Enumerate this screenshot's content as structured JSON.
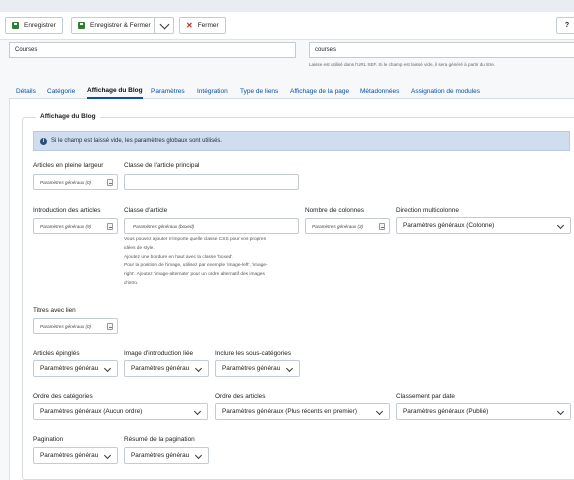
{
  "toolbar": {
    "save_label": "Enregistrer",
    "save_close_label": "Enregistrer & Fermer",
    "close_label": "Fermer",
    "help_label": "?"
  },
  "title": {
    "value": "Courses"
  },
  "alias": {
    "value": "courses",
    "help": "Laisse est utilisé dans l'URL SEF. Si le champ est laissé vide, il sera généré à partir du titre."
  },
  "tabs": [
    {
      "label": "Détails"
    },
    {
      "label": "Catégorie"
    },
    {
      "label": "Affichage du Blog",
      "active": true
    },
    {
      "label": "Paramètres"
    },
    {
      "label": "Intégration"
    },
    {
      "label": "Type de liens"
    },
    {
      "label": "Affichage de la page"
    },
    {
      "label": "Métadonnées"
    },
    {
      "label": "Assignation de modules"
    }
  ],
  "fieldset": {
    "legend": "Affichage du Blog",
    "info": "Si le champ est laissé vide, les paramètres globaux sont utilisés."
  },
  "fields": {
    "leading": {
      "label": "Articles en pleine largeur",
      "value": "Paramètres généraux (0)"
    },
    "leading_class": {
      "label": "Classe de l'article principal",
      "value": ""
    },
    "intro": {
      "label": "Introduction des articles",
      "value": "Paramètres généraux (9)"
    },
    "article_class": {
      "label": "Classe d'article",
      "value": "Paramètres généraux (boxed)",
      "hint": [
        "Vous pouvez ajouter n'importe quelle classe CSS pour vos propres",
        "idées de style.",
        "Ajoutez une bordure en haut avec la classe 'boxed'.",
        "Pour la position de l'image, utilisez par exemple 'image-left', 'image-",
        "right'. Ajoutez 'image-alternate' pour un ordre alternatif des images",
        "d'intro."
      ]
    },
    "columns": {
      "label": "Nombre de colonnes",
      "value": "Paramètres généraux (3)"
    },
    "direction": {
      "label": "Direction multicolonne",
      "value": "Paramètres généraux (Colonne)"
    },
    "links": {
      "label": "Titres avec lien",
      "value": "Paramètres généraux (0)"
    },
    "pinned": {
      "label": "Articles épinglés",
      "value": "Paramètres générau"
    },
    "linked_image": {
      "label": "Image d'introduction liée",
      "value": "Paramètres générau"
    },
    "subcats": {
      "label": "Inclure les sous-catégories",
      "value": "Paramètres générau"
    },
    "cat_order": {
      "label": "Ordre des catégories",
      "value": "Paramètres généraux (Aucun ordre)"
    },
    "article_order": {
      "label": "Ordre des articles",
      "value": "Paramètres généraux (Plus récents en premier)"
    },
    "date_order": {
      "label": "Classement par date",
      "value": "Paramètres généraux (Publié)"
    },
    "pagination": {
      "label": "Pagination",
      "value": "Paramètres générau"
    },
    "pagination_summary": {
      "label": "Résumé de la pagination",
      "value": "Paramètres générau"
    }
  }
}
